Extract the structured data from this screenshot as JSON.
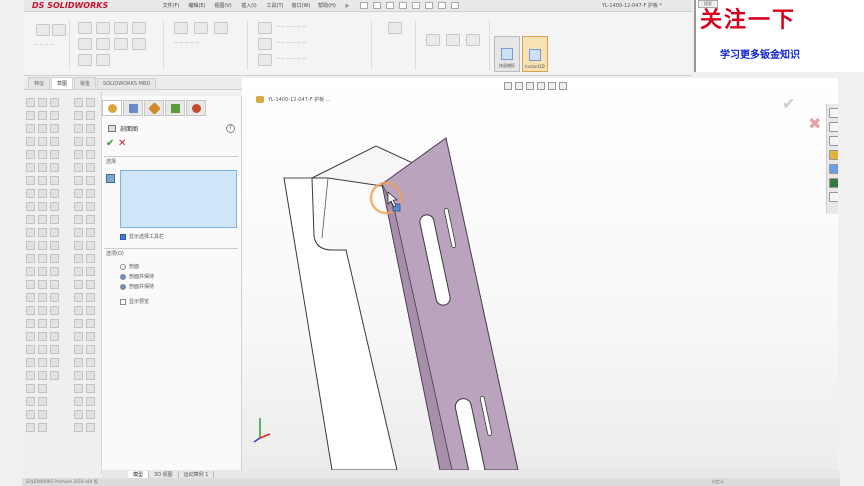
{
  "titlebar": {
    "logo_ds": "DS",
    "logo_text": "SOLIDWORKS",
    "menu": [
      "文件(F)",
      "编辑(E)",
      "视图(V)",
      "插入(I)",
      "工具(T)",
      "窗口(W)",
      "帮助(H)"
    ],
    "document": "YL-1400-12-047-F 护板 *"
  },
  "promo": {
    "title": "关注一下",
    "subtitle": "学习更多钣金知识",
    "tag": "搜索"
  },
  "ribbon": {
    "big_buttons": [
      "快速捕捉",
      "Instant2D"
    ]
  },
  "command_tabs": [
    "特征",
    "草图",
    "钣金",
    "SOLIDWORKS MBD"
  ],
  "property_manager": {
    "feature_name": "剖面图",
    "help": "?",
    "ok": "✔",
    "cancel": "✕",
    "section_selection": "选择",
    "show_toolbar": "显示选择工具栏",
    "section_options": "选项(O)",
    "option_1": "剖面",
    "option_2": "剖面并保持",
    "option_3": "剖面并保持",
    "show_preview": "显示预览"
  },
  "viewport": {
    "document_node": "YL-1400-12-047-F 护板 ...",
    "confirm_ok": "✔",
    "confirm_cancel": "✖"
  },
  "bottom_tabs": [
    "模型",
    "3D 视图",
    "运动算例 1"
  ],
  "status": {
    "left": "SOLIDWORKS Premium 2018 x64 版",
    "right": "自定义"
  },
  "colors": {
    "sheet_metal_face": "#b9a3bd",
    "sheet_metal_shadow": "#a58fa9",
    "selection_box": "#cfe6f8",
    "promo_title": "#d6001c",
    "promo_subtitle": "#1122cc"
  }
}
